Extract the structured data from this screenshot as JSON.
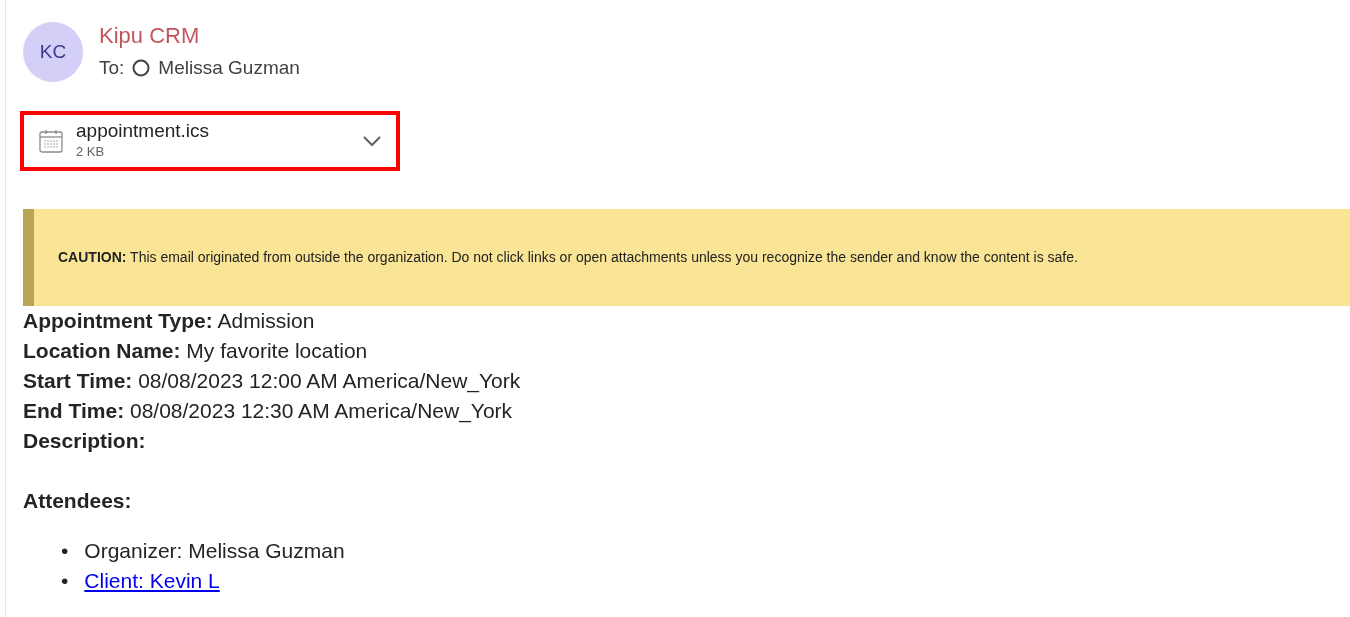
{
  "sender": {
    "initials": "KC",
    "name": "Kipu CRM",
    "to_label": "To:",
    "recipient": "Melissa Guzman"
  },
  "attachment": {
    "filename": "appointment.ics",
    "size": "2 KB",
    "highlighted": true
  },
  "caution": {
    "label": "CAUTION:",
    "text": "This email originated from outside the organization. Do not click links or open attachments unless you recognize the sender and know the content is safe."
  },
  "fields": [
    "**Appointment Type:** Admission",
    "**Location Name:** My favorite location",
    "**Start Time:** 08/08/2023 12:00 AM America/New_York",
    "**End Time:** 08/08/2023 12:30 AM America/New_York"
  ],
  "description_label": "Description:",
  "attendees_label": "Attendees:",
  "attendees": [
    {
      "kind": "text",
      "bullet": "•",
      "text": "Organizer: Melissa Guzman"
    },
    {
      "kind": "link",
      "bullet": "•",
      "text": "Client: Kevin L"
    }
  ]
}
